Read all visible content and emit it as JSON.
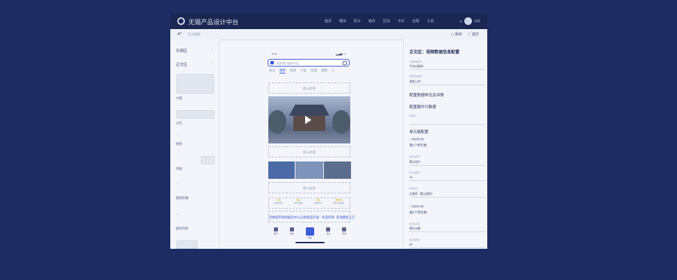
{
  "app": {
    "title": "无锡产品设计中台"
  },
  "nav": [
    "首页",
    "模块",
    "原子",
    "组件",
    "区块",
    "卡片",
    "全局",
    "工具"
  ],
  "user": {
    "name": "刘玲"
  },
  "subbar": {
    "back_icon": "undo-icon",
    "hint": "无法撤销",
    "save": "保存",
    "publish": "提交"
  },
  "left": {
    "sections": [
      "头部区",
      "正文区"
    ],
    "items": [
      "大图",
      "公告",
      "链接",
      "单图",
      "超链轮播",
      "图标列表"
    ]
  },
  "phone": {
    "time": "9:41",
    "search_placeholder": "搜索感兴趣的内容",
    "tabs": [
      "关注",
      "推荐",
      "热榜",
      "小说",
      "动漫",
      "视频"
    ],
    "slot_label": "嵌入此处",
    "stats": [
      {
        "value": "33",
        "label": "累计用户"
      },
      {
        "value": "89",
        "label": "本年活跃"
      },
      {
        "value": "55",
        "label": "新增用户"
      },
      {
        "value": "8888",
        "label": "累计访问量"
      }
    ],
    "ticker": "无锡城市规划展览中心已经建成开放 · 欢迎参观·",
    "ticker2": "其他最新上方",
    "bottom": [
      "首页",
      "热榜",
      "发布",
      "消息",
      "我的"
    ]
  },
  "right": {
    "title": "正文区：视频数据信息配置",
    "f1_label": "视频数据来源",
    "f1_value": "平台内容库",
    "f2_label": "选择视频数据",
    "f2_value": "视频上传",
    "h1": "配置数据样式及详情",
    "h2": "配置额外行数据",
    "f3_label": "标题栏",
    "h3": "单元格配置",
    "add1": "+ 添加单元格",
    "cell1": "第1个单元格",
    "f4_label": "单元格名称",
    "f4_value": "累计用户",
    "f5_label": "单元格数值",
    "f5_value": "33",
    "f6_label": "数值颜色",
    "f6_value": "红黄色（默认颜色）",
    "add2": "+ 添加单元格",
    "cell2": "第2个单元格",
    "f7_label": "单元格名称",
    "f7_value": "累计访客",
    "f8_label": "单元格数值",
    "f8_value": "89"
  }
}
